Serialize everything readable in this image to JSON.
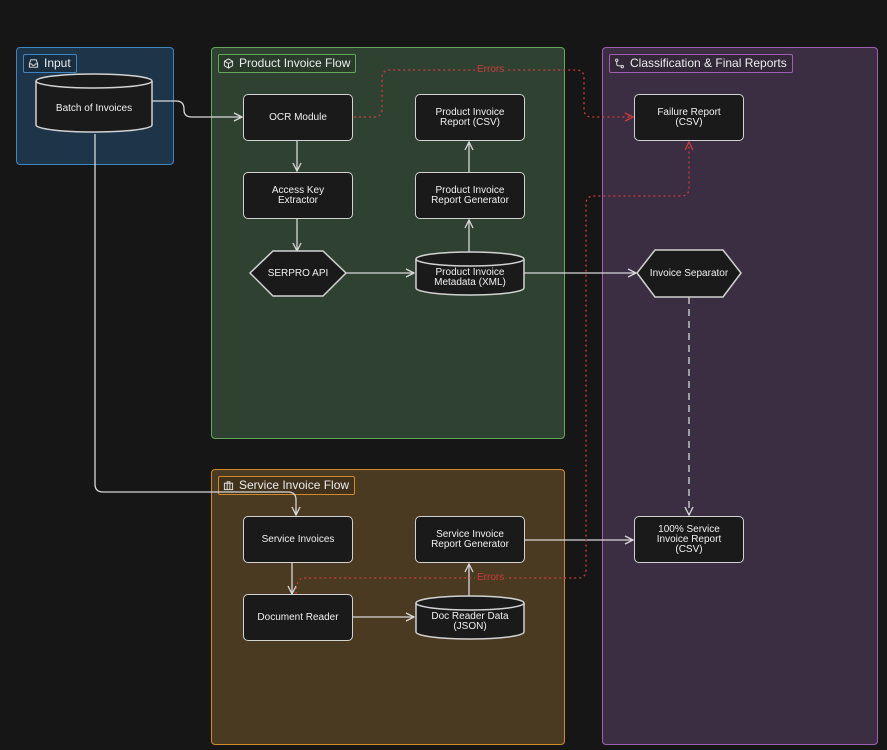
{
  "groups": {
    "input": {
      "label": "Input",
      "icon": "inbox-icon",
      "color": "#3b86c4"
    },
    "product": {
      "label": "Product Invoice Flow",
      "icon": "package-icon",
      "color": "#63a85b"
    },
    "service": {
      "label": "Service Invoice Flow",
      "icon": "briefcase-icon",
      "color": "#d1892a"
    },
    "classification": {
      "label": "Classification & Final Reports",
      "icon": "route-icon",
      "color": "#a05db4"
    }
  },
  "nodes": {
    "batch": "Batch of Invoices",
    "ocr": "OCR Module",
    "access_key": "Access Key\nExtractor",
    "serpro": "SERPRO API",
    "product_meta": "Product Invoice\nMetadata (XML)",
    "product_gen": "Product Invoice\nReport Generator",
    "product_csv": "Product Invoice\nReport (CSV)",
    "failure": "Failure Report\n(CSV)",
    "separator": "Invoice Separator",
    "service_invoices": "Service Invoices",
    "doc_reader": "Document Reader",
    "doc_data": "Doc Reader Data\n(JSON)",
    "service_gen": "Service Invoice\nReport Generator",
    "service_csv": "100% Service\nInvoice Report\n(CSV)"
  },
  "edges": {
    "errors_top": "Errors",
    "errors_bottom": "Errors"
  },
  "colors": {
    "background": "#161616",
    "edge": "#d8d8d8",
    "error_edge": "#cf3b3b"
  }
}
